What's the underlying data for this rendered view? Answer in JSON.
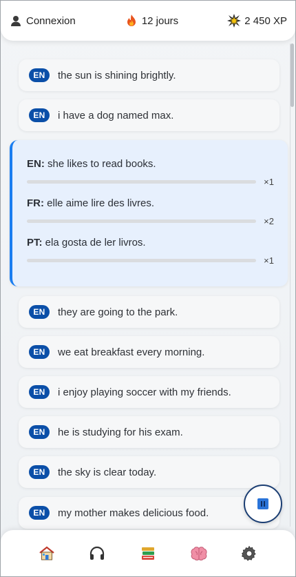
{
  "header": {
    "login_label": "Connexion",
    "streak_label": "12 jours",
    "xp_label": "2 450 XP"
  },
  "phrases_top": [
    {
      "lang": "EN",
      "text": "the sun is shining brightly."
    },
    {
      "lang": "EN",
      "text": "i have a dog named max."
    }
  ],
  "expanded": {
    "translations": [
      {
        "lang": "EN:",
        "text": "she likes to read books.",
        "count": "×1"
      },
      {
        "lang": "FR:",
        "text": "elle aime lire des livres.",
        "count": "×2"
      },
      {
        "lang": "PT:",
        "text": "ela gosta de ler livros.",
        "count": "×1"
      }
    ]
  },
  "phrases_bottom": [
    {
      "lang": "EN",
      "text": "they are going to the park."
    },
    {
      "lang": "EN",
      "text": "we eat breakfast every morning."
    },
    {
      "lang": "EN",
      "text": "i enjoy playing soccer with my friends."
    },
    {
      "lang": "EN",
      "text": "he is studying for his exam."
    },
    {
      "lang": "EN",
      "text": "the sky is clear today."
    },
    {
      "lang": "EN",
      "text": "my mother makes delicious food."
    }
  ],
  "nav": {
    "icons": [
      "home-icon",
      "headphones-icon",
      "books-icon",
      "brain-icon",
      "gear-icon"
    ]
  },
  "colors": {
    "accent": "#1a7df0",
    "badge": "#0b4fa8",
    "expanded_bg": "#e7f0fd"
  }
}
